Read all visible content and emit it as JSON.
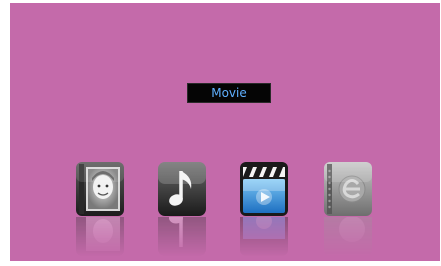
{
  "menu": {
    "selected_label": "Movie",
    "items": [
      {
        "id": "photo",
        "icon": "photo-album-icon"
      },
      {
        "id": "music",
        "icon": "music-note-icon"
      },
      {
        "id": "movie",
        "icon": "clapperboard-icon"
      },
      {
        "id": "ebook",
        "icon": "ebook-icon"
      }
    ]
  },
  "colors": {
    "background": "#c46aaa",
    "label_text": "#5fb0ff",
    "label_bg": "#050505"
  }
}
